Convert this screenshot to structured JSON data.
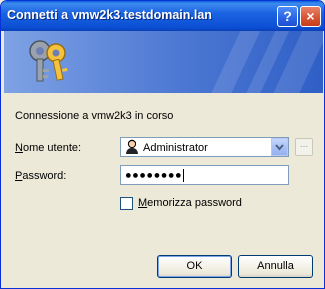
{
  "window": {
    "title": "Connetti a vmw2k3.testdomain.lan",
    "help_label": "?",
    "close_label": "×"
  },
  "message": "Connessione a vmw2k3 in corso",
  "fields": {
    "username": {
      "label_accel": "N",
      "label_rest": "ome utente:",
      "value": "Administrator"
    },
    "password": {
      "label_accel": "P",
      "label_rest": "assword:",
      "value": "●●●●●●●●"
    },
    "browse_label": "..."
  },
  "remember": {
    "label_accel": "M",
    "label_rest": "emorizza password",
    "checked": false
  },
  "buttons": {
    "ok": "OK",
    "cancel": "Annulla"
  },
  "colors": {
    "titlebar": "#0b4fd4",
    "banner": "#4d78d3",
    "dialog_bg": "#ece9d8"
  }
}
